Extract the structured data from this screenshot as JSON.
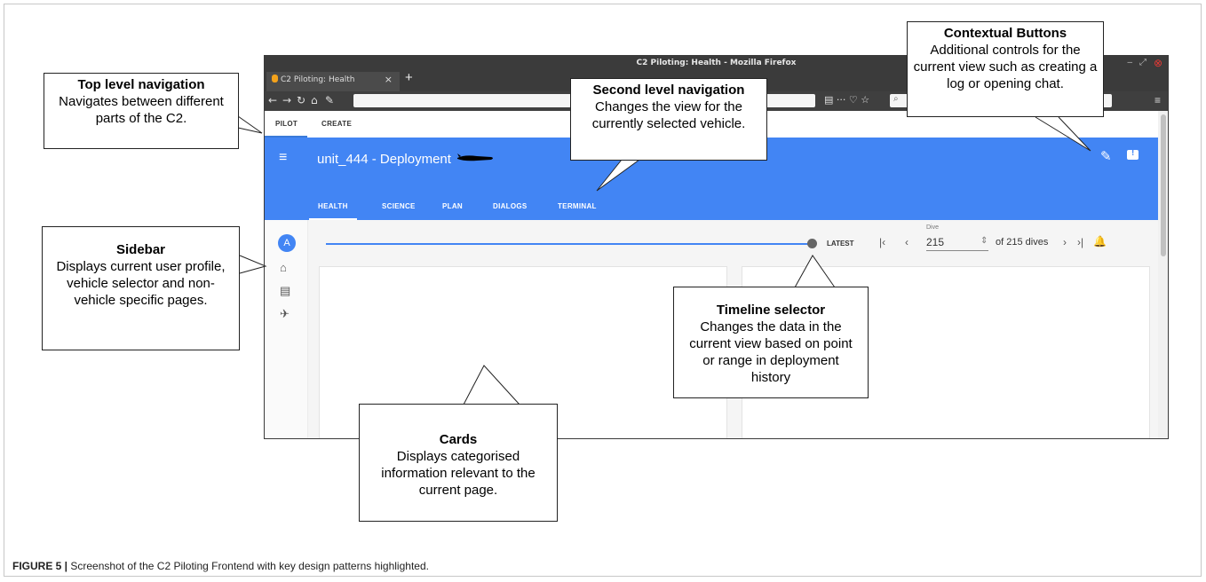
{
  "window": {
    "title": "C2 Piloting: Health - Mozilla Firefox",
    "tab_label": "C2 Piloting: Health"
  },
  "top_nav": [
    "PILOT",
    "CREATE"
  ],
  "header": {
    "unit": "unit_444",
    "separator": "-",
    "deployment": "Deployment"
  },
  "sub_nav": [
    "HEALTH",
    "SCIENCE",
    "PLAN",
    "DIALOGS",
    "TERMINAL"
  ],
  "sidebar": {
    "avatar_letter": "A"
  },
  "timeline": {
    "latest": "LATEST",
    "dive_label": "Dive",
    "dive_value": "215",
    "of_dives": "of 215 dives"
  },
  "callouts": {
    "top_nav": {
      "title": "Top level navigation",
      "body": "Navigates between different parts of the C2."
    },
    "second_nav": {
      "title": "Second level navigation",
      "body": "Changes the view for the currently selected vehicle."
    },
    "contextual": {
      "title": "Contextual Buttons",
      "body": "Additional controls for the current view such as creating a log or opening chat."
    },
    "sidebar": {
      "title": "Sidebar",
      "body": "Displays current user profile, vehicle selector and non-vehicle specific pages."
    },
    "timeline": {
      "title": "Timeline selector",
      "body": "Changes the data in the current view based on point or range in deployment history"
    },
    "cards": {
      "title": "Cards",
      "body": "Displays categorised information relevant to the current page."
    }
  },
  "caption": {
    "label": "FIGURE 5 |",
    "text": " Screenshot of the C2 Piloting Frontend with key design patterns highlighted."
  }
}
